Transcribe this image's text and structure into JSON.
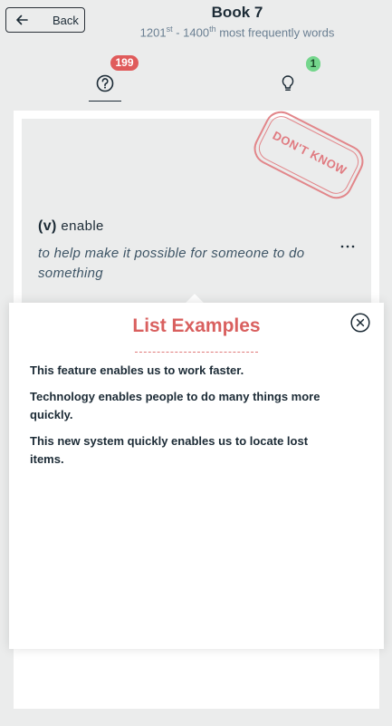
{
  "header": {
    "back_label": "Back",
    "title": "Book 7",
    "subtitle": {
      "start": "1201",
      "start_suffix": "st",
      "separator": " - ",
      "end": "1400",
      "end_suffix": "th",
      "rest": " most frequently words"
    }
  },
  "tabs": {
    "unknown_count": "199",
    "known_count": "1"
  },
  "card": {
    "stamp_text": "DON'T KNOW",
    "part_of_speech": "(v)",
    "word": "enable",
    "definition": "to help make it possible for someone to do something"
  },
  "popover": {
    "title": "List Examples",
    "examples": [
      "This feature enables us to work faster.",
      "Technology enables people to do many things more quickly.",
      "This new system quickly enables us to locate lost items."
    ]
  },
  "colors": {
    "background": "#ebecec",
    "accent_red": "#d9605f",
    "badge_red": "#e05b5b",
    "badge_green": "#74d68c",
    "text_dark": "#1c2b36",
    "text_muted": "#6a7f92"
  },
  "icons": {
    "back": "arrow-left-icon",
    "unknown_tab": "question-circle-icon",
    "known_tab": "lightbulb-icon",
    "more": "ellipsis-icon",
    "close": "close-circle-icon"
  }
}
